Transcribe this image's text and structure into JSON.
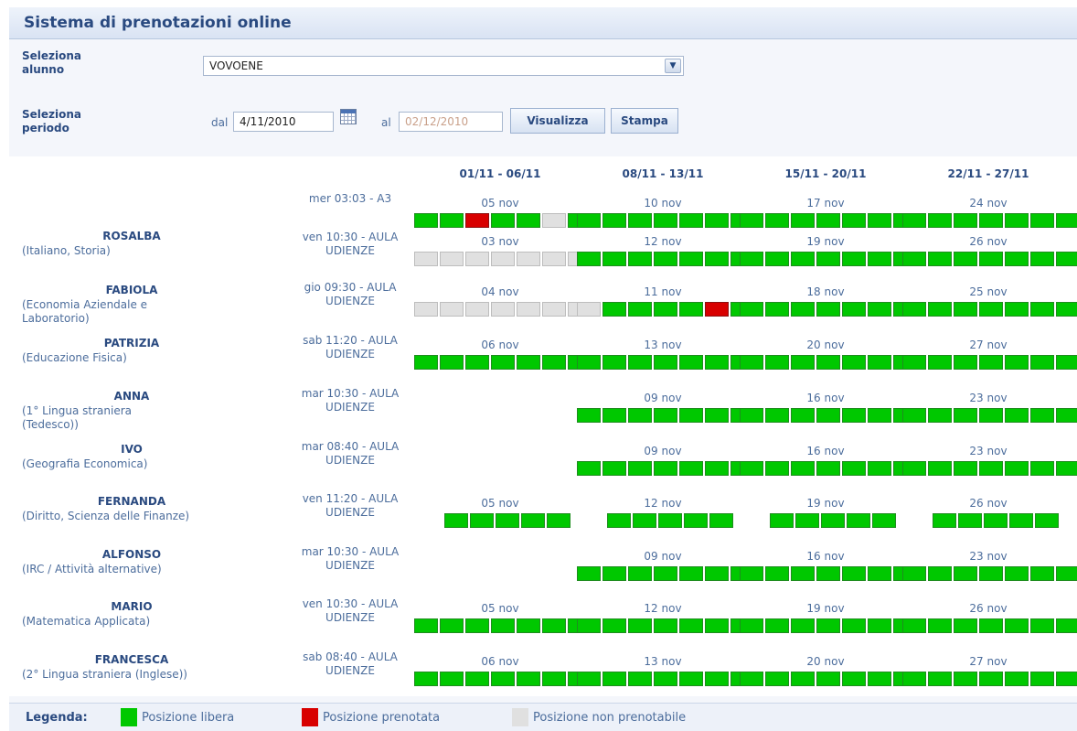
{
  "app": {
    "title": "Sistema di prenotazioni online"
  },
  "form": {
    "student_label_1": "Seleziona",
    "student_label_2": "alunno",
    "student_value": "VOVOENE",
    "period_label_1": "Seleziona",
    "period_label_2": "periodo",
    "from_label": "dal",
    "from_value": "4/11/2010",
    "to_label": "al",
    "to_value": "02/12/2010",
    "show_button": "Visualizza",
    "print_button": "Stampa"
  },
  "colors": {
    "free": "#00c800",
    "booked": "#d80000",
    "unavailable": "#e0e0e0"
  },
  "weeks": [
    "01/11 - 06/11",
    "08/11 - 13/11",
    "15/11 - 20/11",
    "22/11 - 27/11"
  ],
  "teachers": [
    {
      "name": "ROSALBA",
      "subject_lines": [
        "(Italiano, Storia)"
      ],
      "slots": [
        {
          "time": [
            "mer 03:03 - A3"
          ],
          "days": [
            {
              "label": "05 nov",
              "cells": "ffbffnf"
            },
            {
              "label": "10 nov",
              "cells": "fffffff"
            },
            {
              "label": "17 nov",
              "cells": "fffffff"
            },
            {
              "label": "24 nov",
              "cells": "fffffff"
            }
          ]
        },
        {
          "time": [
            "ven 10:30 - AULA",
            "UDIENZE"
          ],
          "days": [
            {
              "label": "03 nov",
              "cells": "nnnnnnn"
            },
            {
              "label": "12 nov",
              "cells": "fffffff"
            },
            {
              "label": "19 nov",
              "cells": "fffffff"
            },
            {
              "label": "26 nov",
              "cells": "fffffff"
            }
          ]
        }
      ]
    },
    {
      "name": "FABIOLA",
      "subject_lines": [
        "(Economia Aziendale e",
        "Laboratorio)"
      ],
      "slots": [
        {
          "time": [
            "gio 09:30 - AULA",
            "UDIENZE"
          ],
          "days": [
            {
              "label": "04 nov",
              "cells": "nnnnnnn"
            },
            {
              "label": "11 nov",
              "cells": "nffffbf"
            },
            {
              "label": "18 nov",
              "cells": "fffffff"
            },
            {
              "label": "25 nov",
              "cells": "fffffff"
            }
          ]
        }
      ]
    },
    {
      "name": "PATRIZIA",
      "subject_lines": [
        "(Educazione Fisica)"
      ],
      "slots": [
        {
          "time": [
            "sab 11:20 - AULA",
            "UDIENZE"
          ],
          "days": [
            {
              "label": "06 nov",
              "cells": "fffffff"
            },
            {
              "label": "13 nov",
              "cells": "fffffff"
            },
            {
              "label": "20 nov",
              "cells": "fffffff"
            },
            {
              "label": "27 nov",
              "cells": "fffffff"
            }
          ]
        }
      ]
    },
    {
      "name": "ANNA",
      "subject_lines": [
        "(1° Lingua straniera",
        "(Tedesco))"
      ],
      "slots": [
        {
          "time": [
            "mar 10:30 - AULA",
            "UDIENZE"
          ],
          "days": [
            null,
            {
              "label": "09 nov",
              "cells": "fffffff"
            },
            {
              "label": "16 nov",
              "cells": "fffffff"
            },
            {
              "label": "23 nov",
              "cells": "fffffff"
            }
          ]
        }
      ]
    },
    {
      "name": "IVO",
      "subject_lines": [
        "(Geografia Economica)"
      ],
      "slots": [
        {
          "time": [
            "mar 08:40 - AULA",
            "UDIENZE"
          ],
          "days": [
            null,
            {
              "label": "09 nov",
              "cells": "fffffff"
            },
            {
              "label": "16 nov",
              "cells": "fffffff"
            },
            {
              "label": "23 nov",
              "cells": "fffffff"
            }
          ]
        }
      ]
    },
    {
      "name": "FERNANDA",
      "subject_lines": [
        "(Diritto, Scienza delle Finanze)"
      ],
      "slots": [
        {
          "time": [
            "ven 11:20 - AULA",
            "UDIENZE"
          ],
          "days": [
            {
              "label": "05 nov",
              "cells": "fffff"
            },
            {
              "label": "12 nov",
              "cells": "fffff"
            },
            {
              "label": "19 nov",
              "cells": "fffff"
            },
            {
              "label": "26 nov",
              "cells": "fffff"
            }
          ]
        }
      ]
    },
    {
      "name": "ALFONSO",
      "subject_lines": [
        "(IRC / Attività alternative)"
      ],
      "slots": [
        {
          "time": [
            "mar 10:30 - AULA",
            "UDIENZE"
          ],
          "days": [
            null,
            {
              "label": "09 nov",
              "cells": "fffffff"
            },
            {
              "label": "16 nov",
              "cells": "fffffff"
            },
            {
              "label": "23 nov",
              "cells": "fffffff"
            }
          ]
        }
      ]
    },
    {
      "name": "MARIO",
      "subject_lines": [
        "(Matematica Applicata)"
      ],
      "slots": [
        {
          "time": [
            "ven 10:30 - AULA",
            "UDIENZE"
          ],
          "days": [
            {
              "label": "05 nov",
              "cells": "fffffff"
            },
            {
              "label": "12 nov",
              "cells": "fffffff"
            },
            {
              "label": "19 nov",
              "cells": "fffffff"
            },
            {
              "label": "26 nov",
              "cells": "fffffff"
            }
          ]
        }
      ]
    },
    {
      "name": "FRANCESCA",
      "subject_lines": [
        "(2° Lingua straniera (Inglese))"
      ],
      "slots": [
        {
          "time": [
            "sab 08:40 - AULA",
            "UDIENZE"
          ],
          "days": [
            {
              "label": "06 nov",
              "cells": "fffffff"
            },
            {
              "label": "13 nov",
              "cells": "fffffff"
            },
            {
              "label": "20 nov",
              "cells": "fffffff"
            },
            {
              "label": "27 nov",
              "cells": "fffffff"
            }
          ]
        }
      ]
    }
  ],
  "legend": {
    "title": "Legenda:",
    "free": "Posizione libera",
    "booked": "Posizione prenotata",
    "unavailable": "Posizione non prenotabile"
  }
}
